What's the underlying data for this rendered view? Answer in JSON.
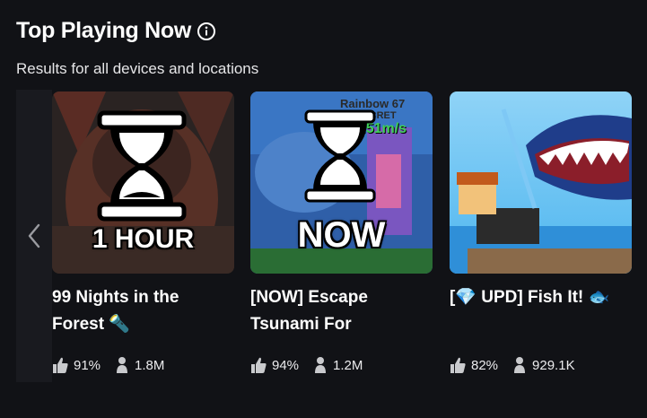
{
  "section": {
    "title": "Top Playing Now",
    "subtitle": "Results for all devices and locations"
  },
  "games": [
    {
      "name_line1": "99 Nights in the",
      "name_line2": "Forest 🔦",
      "thumb_text": "1 HOUR",
      "rating": "91%",
      "players": "1.8M"
    },
    {
      "name_line1": "[NOW] Escape",
      "name_line2": "Tsunami For",
      "thumb_text": "NOW",
      "thumb_small_1": "Rainbow 67",
      "thumb_small_2": "SECRET",
      "thumb_small_3": "$6..51m/s",
      "rating": "94%",
      "players": "1.2M"
    },
    {
      "name_line1": "[💎 UPD] Fish It! 🐟",
      "name_line2": "",
      "rating": "82%",
      "players": "929.1K"
    }
  ],
  "icons": {
    "info": "info-icon",
    "prev": "chevron-left-icon",
    "thumbs_up": "thumbs-up-icon",
    "player": "player-icon",
    "hourglass": "hourglass-icon"
  }
}
